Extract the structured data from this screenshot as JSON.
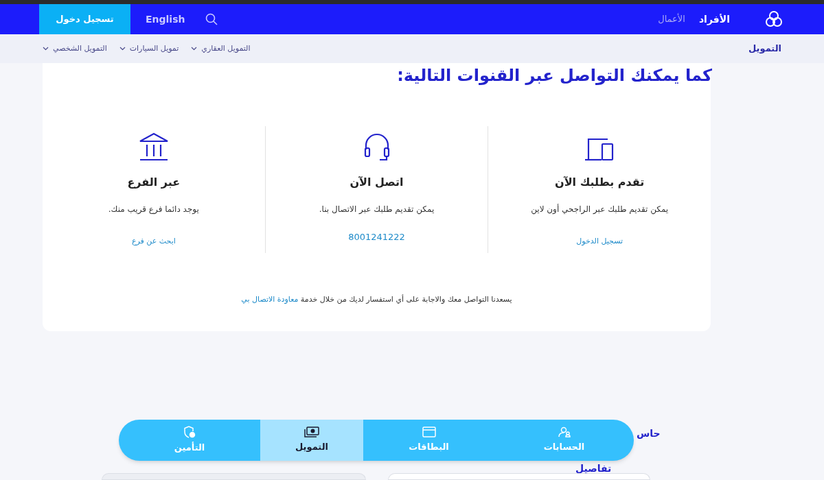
{
  "top_bar": {
    "login_button": "تسجيل دخول",
    "language_link": "English",
    "segments": [
      {
        "label": "الأفراد",
        "selected": true
      },
      {
        "label": "الأعمال",
        "selected": false
      }
    ]
  },
  "sub_nav": {
    "title": "التمويل",
    "menus": [
      "التمويل العقاري",
      "تمويل السيارات",
      "التمويل الشخصي"
    ]
  },
  "channels": {
    "heading": "كما يمكنك التواصل عبر القنوات التالية:",
    "items": [
      {
        "kind": "devices",
        "title": "تقدم بطلبك الآن",
        "text": "يمكن تقديم طلبك عبر الراجحي أون لاين",
        "link": "تسجيل الدخول"
      },
      {
        "kind": "headset",
        "title": "اتصل الآن",
        "text": "يمكن تقديم طلبك عبر الاتصال بنا.",
        "link": "8001241222"
      },
      {
        "kind": "bank",
        "title": "عبر الفرع",
        "text": "يوجد دائما فرع قريب منك.",
        "link": "ابحث عن فرع"
      }
    ],
    "note": "يسعدنا التواصل معك والاجابة على أي استفسار لديك من خلال خدمة",
    "note_link": "معاودة الاتصال بي"
  },
  "behind_texts": [
    "حاس",
    "تفاصيل"
  ],
  "bottom_nav": [
    {
      "kind": "accounts",
      "label": "الحسابات",
      "selected": false
    },
    {
      "kind": "cards",
      "label": "البطاقات",
      "selected": false
    },
    {
      "kind": "finance",
      "label": "التمويل",
      "selected": true
    },
    {
      "kind": "insurance",
      "label": "التأمين",
      "selected": false
    }
  ]
}
